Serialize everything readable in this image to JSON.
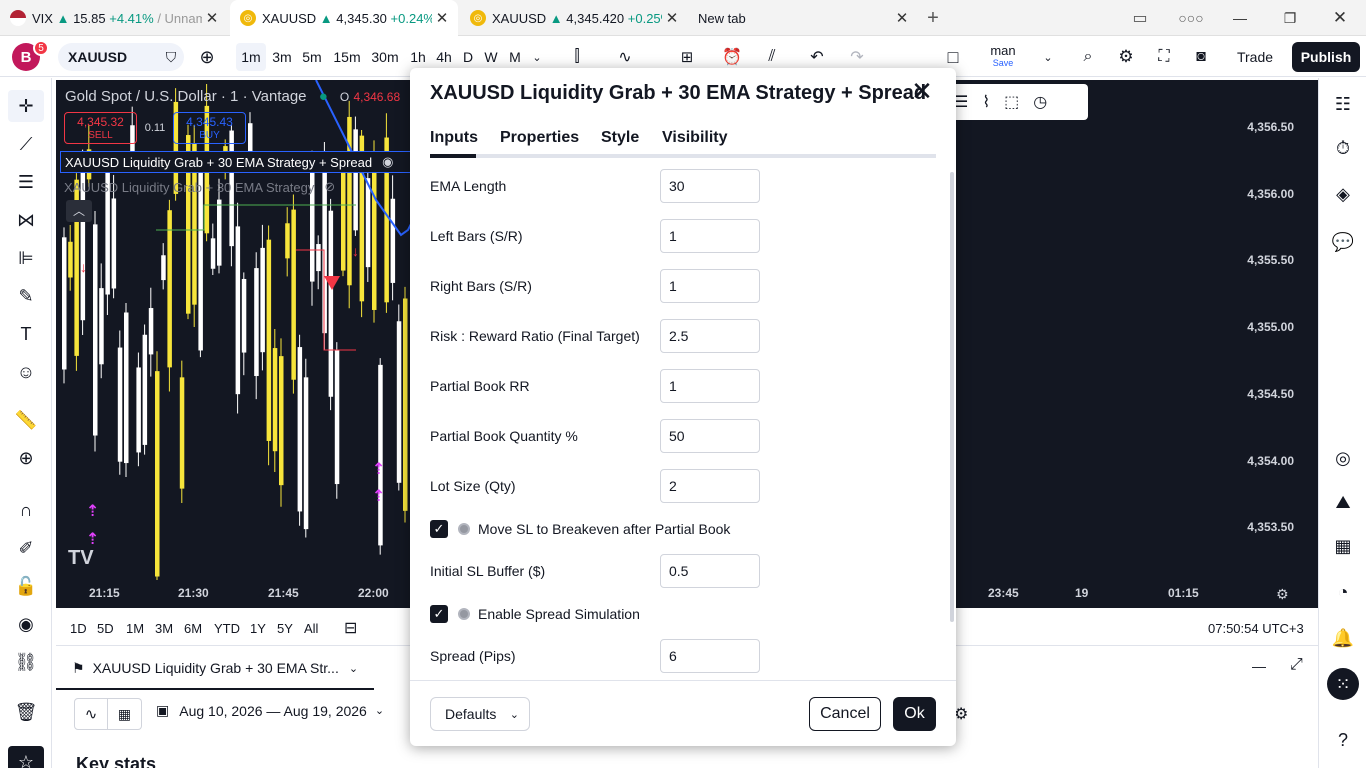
{
  "browser": {
    "tabs": [
      {
        "label_prefix": "VIX ",
        "arrow": "▲",
        "value": "15.85",
        "change": "+4.41%",
        "suffix": " / Unnam"
      },
      {
        "label_prefix": "XAUUSD ",
        "arrow": "▲",
        "value": "4,345.30",
        "change": "+0.24%",
        "suffix": ""
      },
      {
        "label_prefix": "XAUUSD ",
        "arrow": "▲",
        "value": "4,345.420",
        "change": "+0.25%",
        "suffix": ""
      },
      {
        "label_prefix": "New tab",
        "arrow": "",
        "value": "",
        "change": "",
        "suffix": ""
      }
    ],
    "new_tab_icon": "+",
    "window_controls": [
      "minimize",
      "restore",
      "close"
    ]
  },
  "toolbar": {
    "avatar_letter": "B",
    "avatar_badge": "5",
    "symbol": "XAUUSD",
    "intervals": [
      "1m",
      "3m",
      "5m",
      "15m",
      "30m",
      "1h",
      "4h",
      "D",
      "W",
      "M"
    ],
    "layout_name": "man",
    "layout_save": "Save",
    "trade_label": "Trade",
    "publish_label": "Publish",
    "colors": {
      "publish_bg": "#131722",
      "avatar_bg": "#c2185b",
      "badge_bg": "#f23645"
    }
  },
  "chart": {
    "title": "Gold Spot / U.S. Dollar · 1 · Vantage",
    "o_label": "O",
    "o_value": "4,346.68",
    "sell_price": "4,345.32",
    "sell_label": "SELL",
    "spread": "0.11",
    "buy_price": "4,345.43",
    "buy_label": "BUY",
    "indicator_1": "XAUUSD Liquidity Grab + 30 EMA Strategy + Spread",
    "indicator_2": "XAUUSD Liquidity Grab + 30 EMA Strategy",
    "price_labels": [
      "4,356.50",
      "4,356.00",
      "4,355.50",
      "4,355.00",
      "4,354.50",
      "4,354.00",
      "4,353.50"
    ],
    "time_labels": [
      "21:15",
      "21:30",
      "21:45",
      "22:00",
      "23:45",
      "19",
      "01:15"
    ],
    "colors": {
      "background": "#131722",
      "bull": "#f7e53b",
      "bear": "#ffffff",
      "ema": "#2962ff",
      "sell": "#f23645",
      "buy": "#2962ff",
      "marker": "#e040fb"
    }
  },
  "rangebar": {
    "ranges": [
      "1D",
      "5D",
      "1M",
      "3M",
      "6M",
      "YTD",
      "1Y",
      "5Y",
      "All"
    ],
    "clock": "07:50:54 UTC+3"
  },
  "strategy_panel": {
    "tab_label": "XAUUSD Liquidity Grab + 30 EMA Str...",
    "date_range": "Aug 10, 2026 — Aug 19, 2026",
    "section_title": "Key stats"
  },
  "dialog": {
    "title": "XAUUSD Liquidity Grab + 30 EMA Strategy + Spread",
    "tabs": [
      "Inputs",
      "Properties",
      "Style",
      "Visibility"
    ],
    "fields": [
      {
        "label": "EMA Length",
        "value": "30"
      },
      {
        "label": "Left Bars (S/R)",
        "value": "1"
      },
      {
        "label": "Right Bars (S/R)",
        "value": "1"
      },
      {
        "label": "Risk : Reward Ratio (Final Target)",
        "value": "2.5"
      },
      {
        "label": "Partial Book RR",
        "value": "1"
      },
      {
        "label": "Partial Book Quantity %",
        "value": "50"
      },
      {
        "label": "Lot Size (Qty)",
        "value": "2"
      }
    ],
    "checkbox_1": {
      "label": "Move SL to Breakeven after Partial Book",
      "checked": true
    },
    "field_sl": {
      "label": "Initial SL Buffer ($)",
      "value": "0.5"
    },
    "checkbox_2": {
      "label": "Enable Spread Simulation",
      "checked": true
    },
    "field_spread": {
      "label": "Spread (Pips)",
      "value": "6"
    },
    "defaults_label": "Defaults",
    "cancel_label": "Cancel",
    "ok_label": "Ok",
    "checkmark": "✓"
  }
}
